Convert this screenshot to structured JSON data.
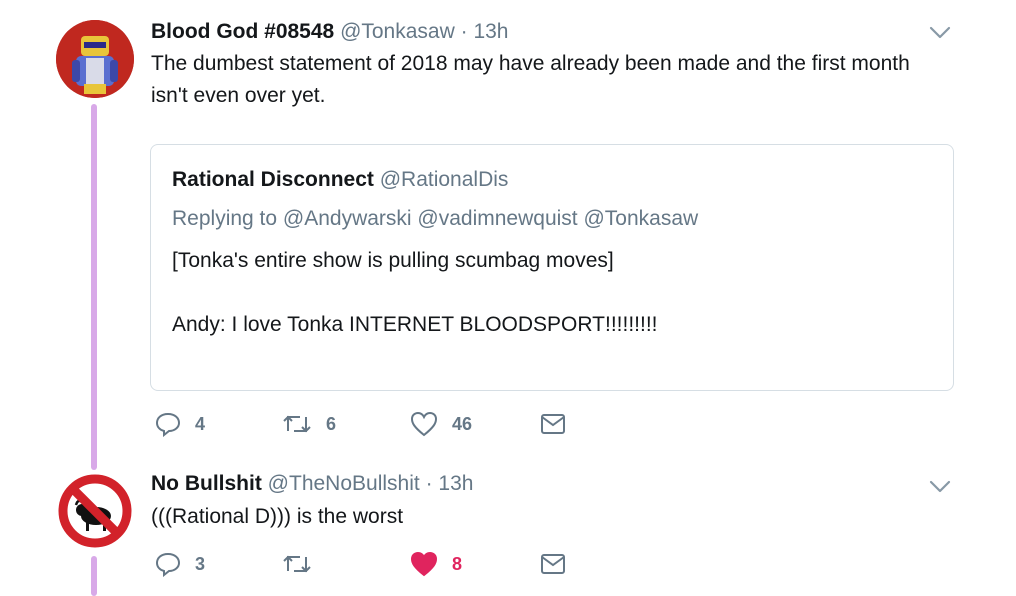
{
  "tweets": [
    {
      "name": "Blood God #08548",
      "handle": "@Tonkasaw",
      "separator": "·",
      "time": "13h",
      "text": "The dumbest statement of 2018 may have already been made and the first month isn't even over yet.",
      "avatar_icon": "robot-avatar",
      "quote": {
        "name": "Rational Disconnect",
        "handle": "@RationalDis",
        "replying": "Replying to @Andywarski @vadimnewquist @Tonkasaw",
        "line1": "[Tonka's entire show is pulling scumbag moves]",
        "line2": "Andy: I love Tonka INTERNET BLOODSPORT!!!!!!!!!"
      },
      "actions": {
        "replies": "4",
        "retweets": "6",
        "likes": "46",
        "liked": false
      }
    },
    {
      "name": "No Bullshit",
      "handle": "@TheNoBullshit",
      "separator": "·",
      "time": "13h",
      "text": "(((Rational D))) is the worst",
      "avatar_icon": "no-bull-sign-avatar",
      "actions": {
        "replies": "3",
        "retweets": "",
        "likes": "8",
        "liked": true
      }
    }
  ],
  "colors": {
    "thread_line": "#d8a9e8",
    "secondary_text": "#657786",
    "like_active": "#e0245e",
    "border": "#d6dee4"
  }
}
